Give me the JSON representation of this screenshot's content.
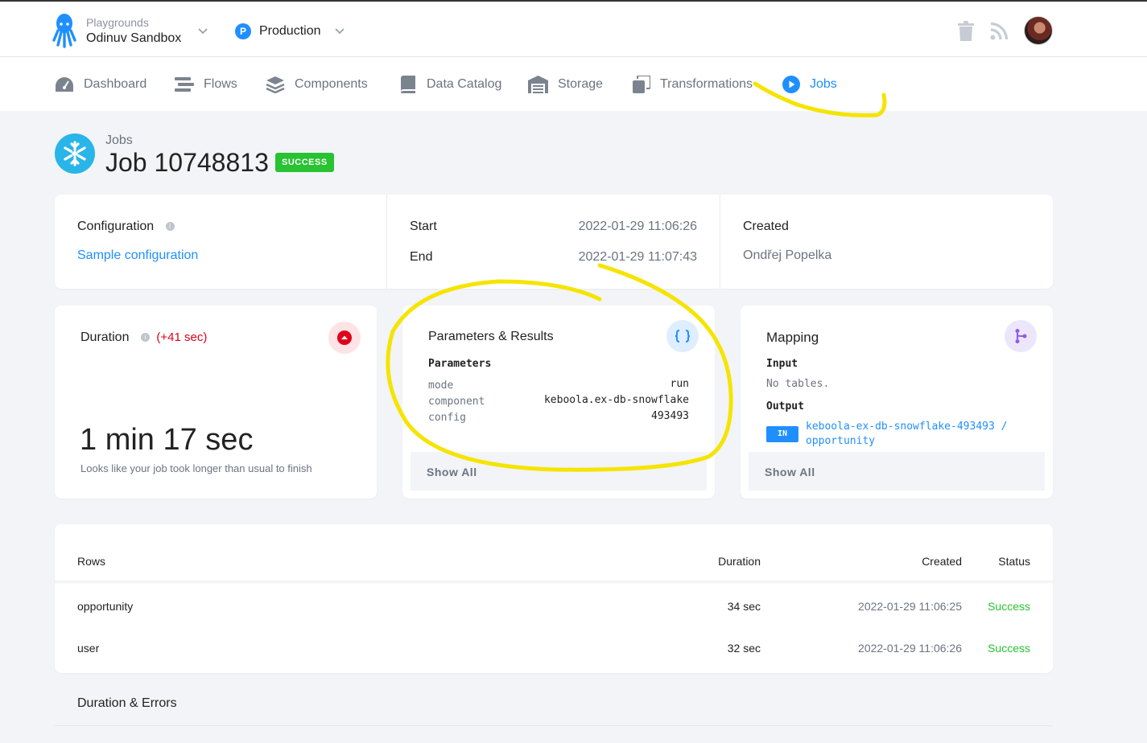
{
  "header": {
    "project_sub": "Playgrounds",
    "project_name": "Odinuv Sandbox",
    "branch_letter": "P",
    "branch_name": "Production"
  },
  "nav": {
    "items": [
      {
        "label": "Dashboard",
        "icon": "gauge-icon"
      },
      {
        "label": "Flows",
        "icon": "flows-icon"
      },
      {
        "label": "Components",
        "icon": "layers-icon"
      },
      {
        "label": "Data Catalog",
        "icon": "book-icon"
      },
      {
        "label": "Storage",
        "icon": "warehouse-icon"
      },
      {
        "label": "Transformations",
        "icon": "copy-icon"
      },
      {
        "label": "Jobs",
        "icon": "play-circle-icon"
      }
    ],
    "active": "Jobs"
  },
  "page": {
    "crumb": "Jobs",
    "title": "Job 10748813",
    "status_badge": "SUCCESS"
  },
  "info": {
    "configuration_label": "Configuration",
    "configuration_link": "Sample configuration",
    "start_label": "Start",
    "start_value": "2022-01-29 11:06:26",
    "end_label": "End",
    "end_value": "2022-01-29 11:07:43",
    "created_label": "Created",
    "created_value": "Ondřej Popelka"
  },
  "duration": {
    "title": "Duration",
    "delta": "(+41 sec)",
    "value": "1 min 17 sec",
    "note": "Looks like your job took longer than usual to finish"
  },
  "params": {
    "title": "Parameters & Results",
    "section": "Parameters",
    "rows": [
      {
        "key": "mode",
        "value": "run"
      },
      {
        "key": "component",
        "value": "keboola.ex-db-snowflake"
      },
      {
        "key": "config",
        "value": "493493"
      }
    ],
    "show_all": "Show All"
  },
  "mapping": {
    "title": "Mapping",
    "input_label": "Input",
    "input_value": "No tables.",
    "output_label": "Output",
    "output_badge": "IN",
    "output_link_1": "keboola-ex-db-snowflake-493493 /",
    "output_link_2": "opportunity",
    "show_all": "Show All"
  },
  "rows_table": {
    "headers": {
      "rows": "Rows",
      "duration": "Duration",
      "created": "Created",
      "status": "Status"
    },
    "rows": [
      {
        "name": "opportunity",
        "duration": "34 sec",
        "created": "2022-01-29 11:06:25",
        "status": "Success"
      },
      {
        "name": "user",
        "duration": "32 sec",
        "created": "2022-01-29 11:06:26",
        "status": "Success"
      }
    ]
  },
  "duration_errors": {
    "title": "Duration & Errors"
  },
  "colors": {
    "accent": "#1f8fff",
    "success": "#28c232",
    "danger": "#e0001b",
    "highlight": "#f5e400"
  }
}
